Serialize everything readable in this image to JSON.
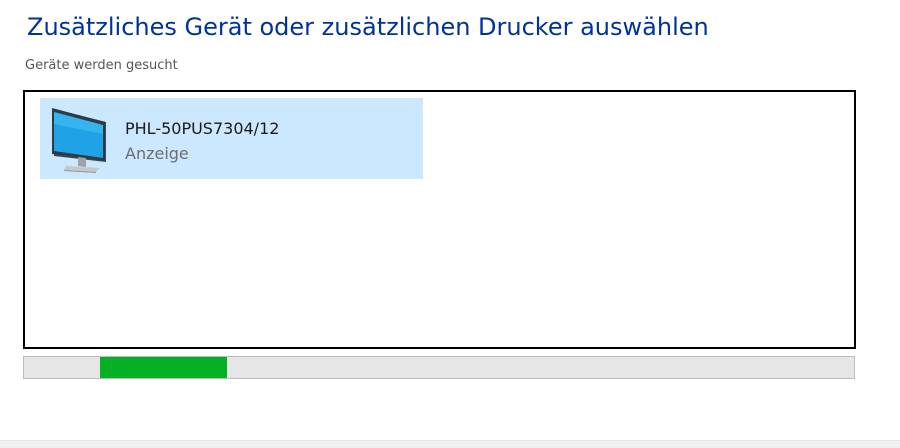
{
  "dialog": {
    "title": "Zusätzliches Gerät oder zusätzlichen Drucker auswählen",
    "status": "Geräte werden gesucht"
  },
  "devices": [
    {
      "name": "PHL-50PUS7304/12",
      "type": "Anzeige",
      "icon": "monitor-icon",
      "selected": true
    }
  ],
  "progress": {
    "mode": "indeterminate",
    "color": "#06b025"
  },
  "colors": {
    "title": "#003399",
    "selection": "#cce8ff",
    "progress": "#06b025"
  }
}
